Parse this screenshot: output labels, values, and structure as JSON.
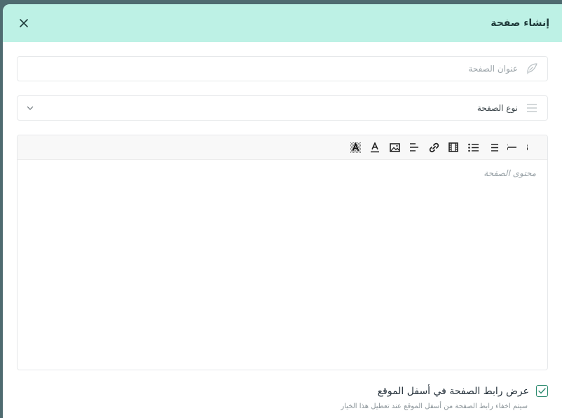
{
  "dialog": {
    "title": "إنشاء صفحة",
    "close_icon": "close-icon"
  },
  "form": {
    "page_title": {
      "placeholder": "عنوان الصفحة",
      "value": "",
      "icon": "feather-icon"
    },
    "page_type": {
      "selected": "نوع الصفحة",
      "icon": "list-icon",
      "chevron": "chevron-down-icon"
    },
    "content": {
      "placeholder": "محتوى الصفحة",
      "toolbar": [
        "bold-icon",
        "strikethrough-icon",
        "ordered-list-icon",
        "unordered-list-icon",
        "video-icon",
        "link-icon",
        "align-left-icon",
        "image-icon",
        "text-color-icon",
        "clear-format-icon"
      ]
    },
    "show_footer_link": {
      "checked": true,
      "label": "عرض رابط الصفحة في أسفل الموقع",
      "hint": "سيتم اخفاء رابط الصفحة من أسفل الموقع عند تعطيل هذا الخيار"
    }
  },
  "colors": {
    "header_bg": "#bdf1e5",
    "accent": "#2b8a6e"
  }
}
